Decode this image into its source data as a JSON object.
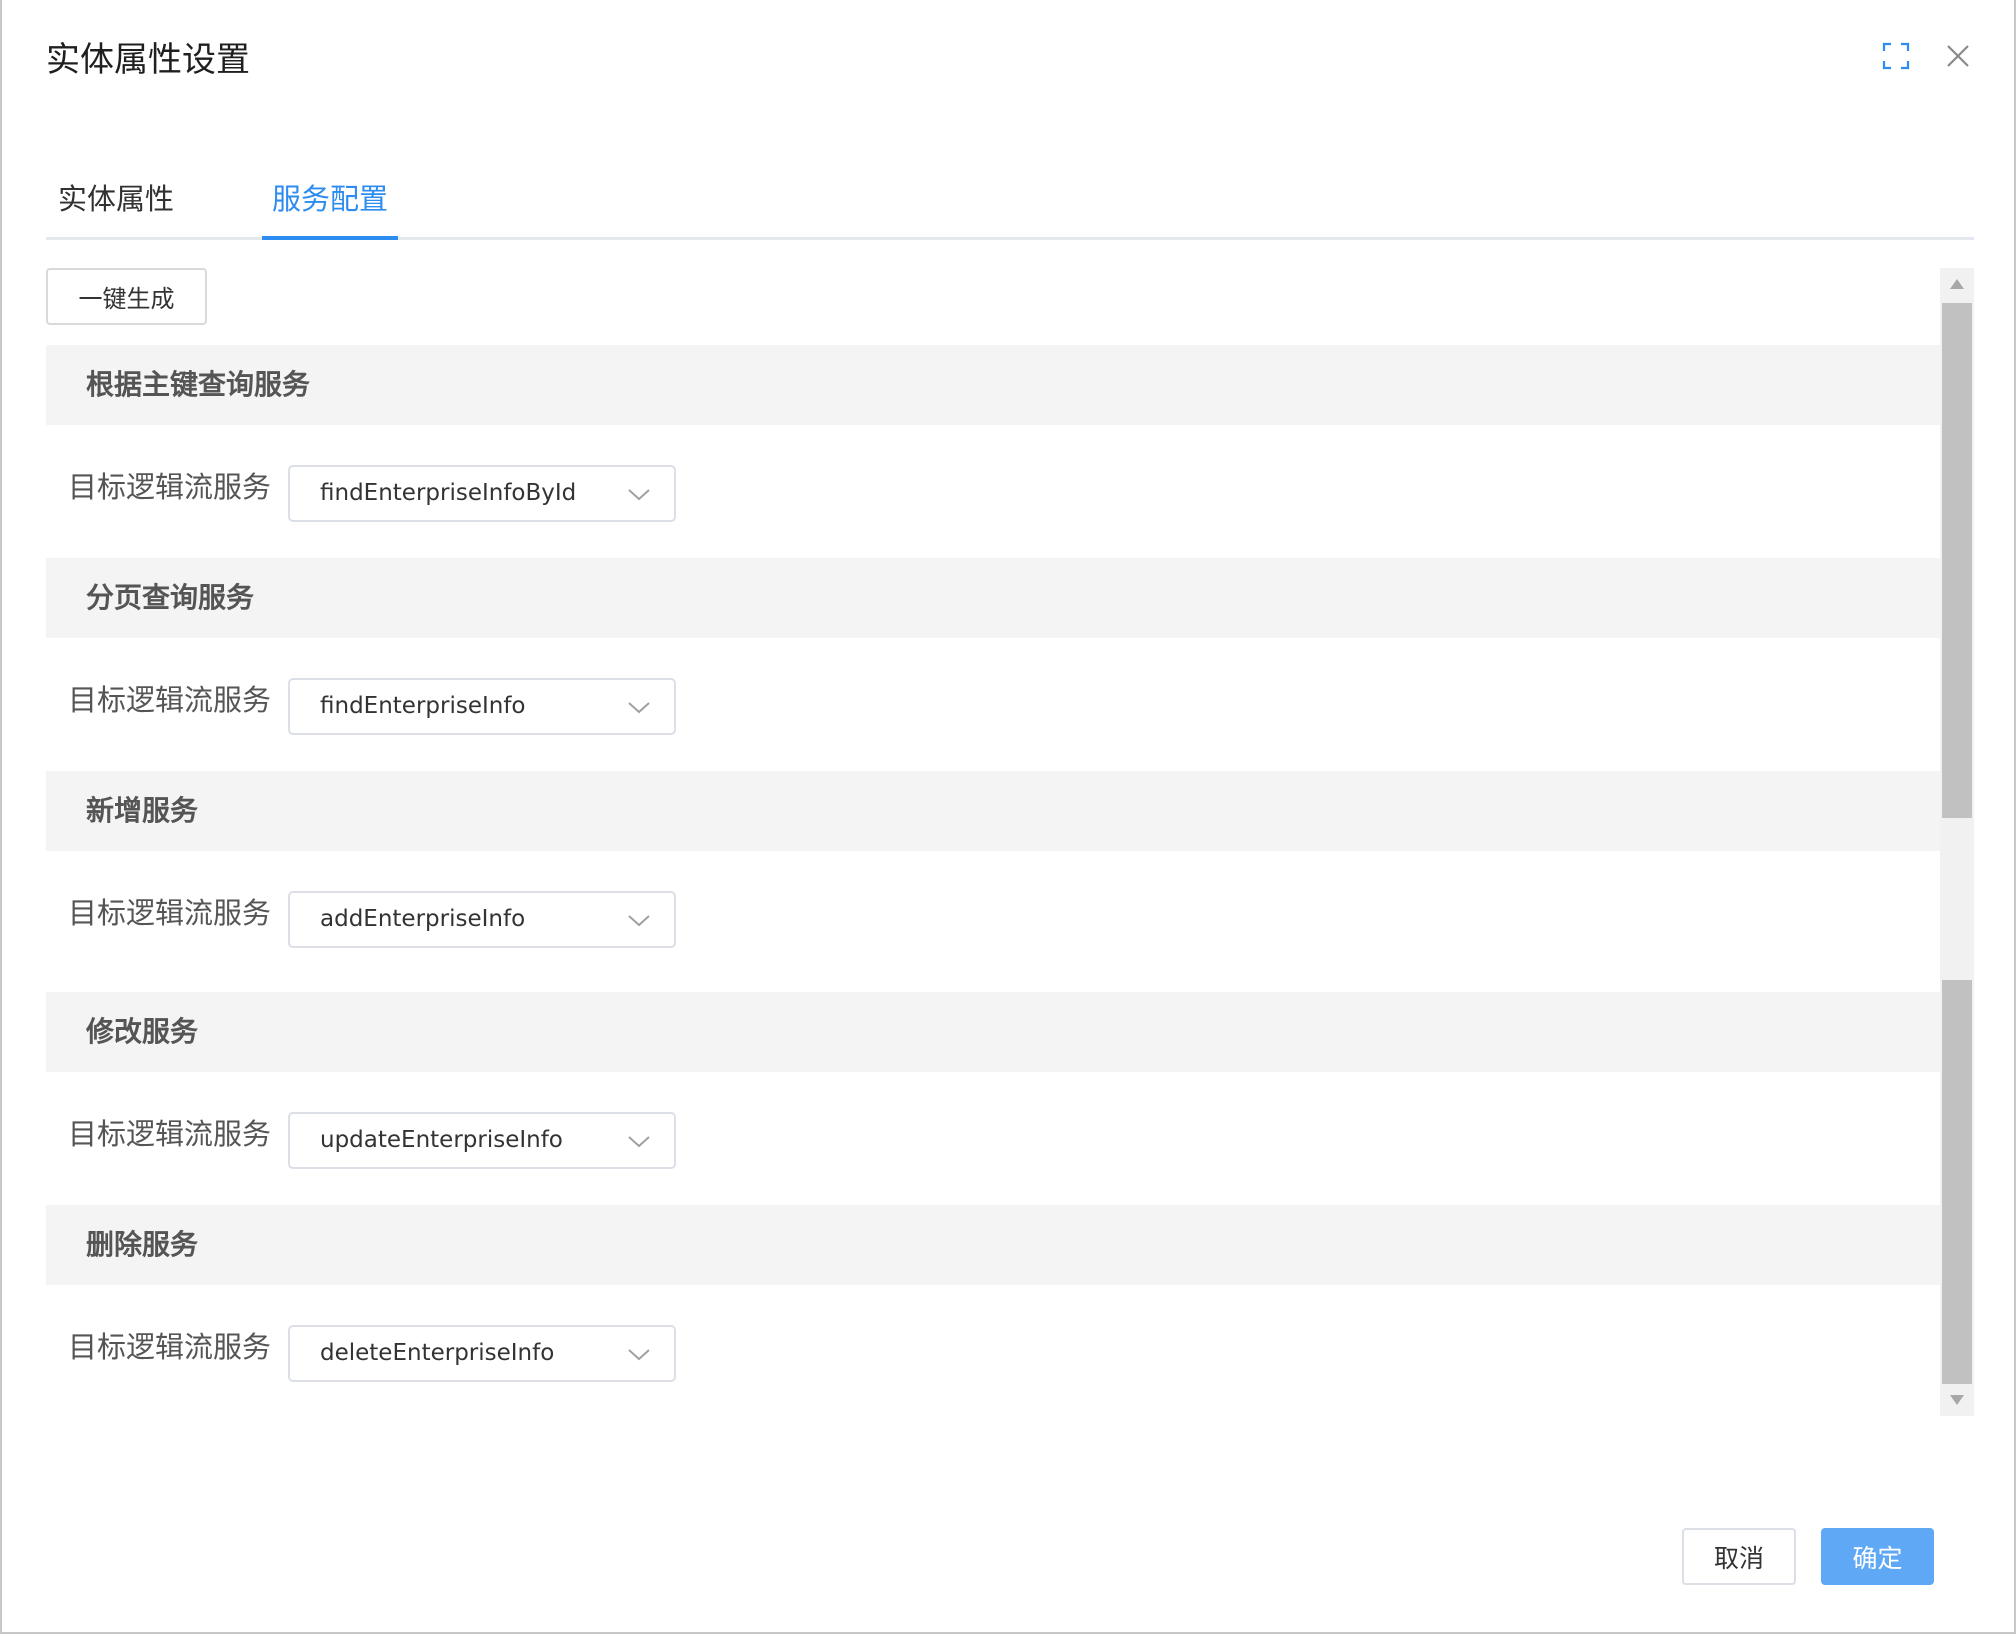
{
  "dialog": {
    "title": "实体属性设置",
    "fullscreen_icon": "fullscreen-icon",
    "close_icon": "close-icon"
  },
  "tabs": [
    {
      "label": "实体属性",
      "active": false
    },
    {
      "label": "服务配置",
      "active": true
    }
  ],
  "toolbar": {
    "generate_label": "一键生成"
  },
  "sections": [
    {
      "title": "根据主键查询服务",
      "field_label": "目标逻辑流服务",
      "value": "findEnterpriseInfoById"
    },
    {
      "title": "分页查询服务",
      "field_label": "目标逻辑流服务",
      "value": "findEnterpriseInfo"
    },
    {
      "title": "新增服务",
      "field_label": "目标逻辑流服务",
      "value": "addEnterpriseInfo"
    },
    {
      "title": "修改服务",
      "field_label": "目标逻辑流服务",
      "value": "updateEnterpriseInfo"
    },
    {
      "title": "删除服务",
      "field_label": "目标逻辑流服务",
      "value": "deleteEnterpriseInfo"
    }
  ],
  "footer": {
    "cancel_label": "取消",
    "ok_label": "确定"
  },
  "colors": {
    "accent": "#2d8cf0",
    "primary_button": "#5fa8f5",
    "section_bg": "#f4f4f4"
  }
}
